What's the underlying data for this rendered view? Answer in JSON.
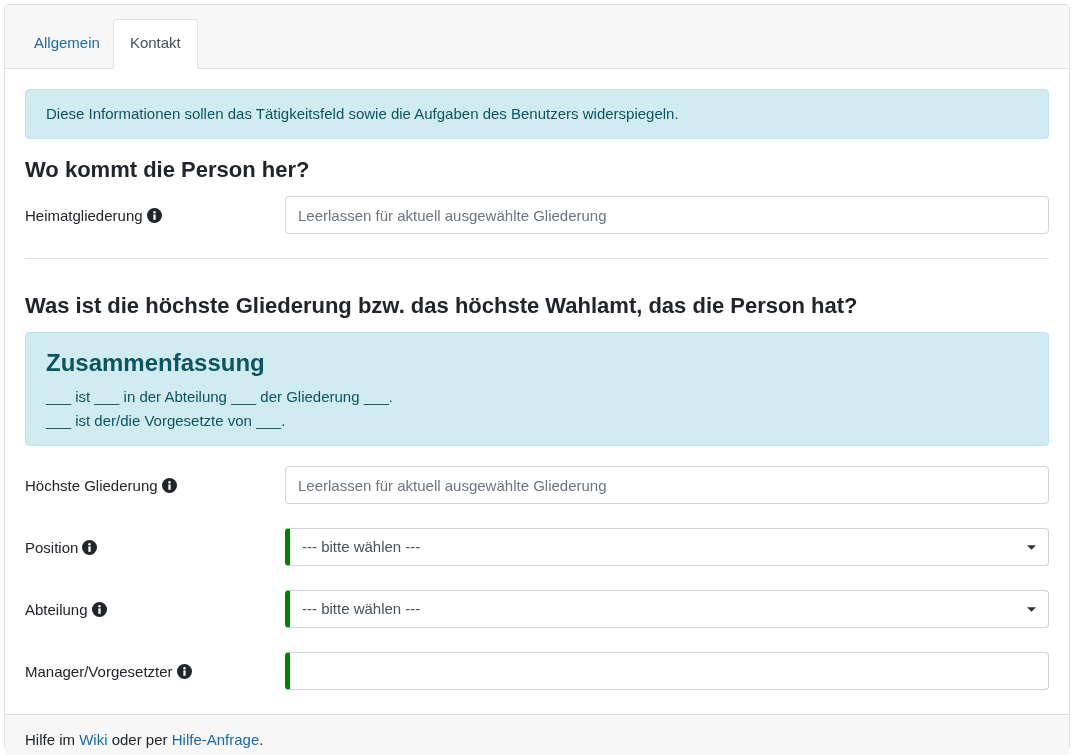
{
  "tabs": [
    {
      "label": "Allgemein",
      "selected": false
    },
    {
      "label": "Kontakt",
      "selected": true
    }
  ],
  "info_alert": "Diese Informationen sollen das Tätigkeitsfeld sowie die Aufgaben des Benutzers widerspiegeln.",
  "sections": [
    {
      "heading": "Wo kommt die Person her?",
      "fields": [
        {
          "kind": "text",
          "label": "Heimatgliederung",
          "placeholder": "Leerlassen für aktuell ausgewählte Gliederung",
          "validated": false
        }
      ]
    },
    {
      "heading": "Was ist die höchste Gliederung bzw. das höchste Wahlamt, das die Person hat?",
      "summary": {
        "title": "Zusammenfassung",
        "lines": [
          "___ ist ___ in der Abteilung ___ der Gliederung ___.",
          "___ ist der/die Vorgesetzte von ___."
        ]
      },
      "fields": [
        {
          "kind": "text",
          "label": "Höchste Gliederung",
          "placeholder": "Leerlassen für aktuell ausgewählte Gliederung",
          "validated": false
        },
        {
          "kind": "select",
          "label": "Position",
          "value": "--- bitte wählen ---",
          "validated": true
        },
        {
          "kind": "select",
          "label": "Abteilung",
          "value": "--- bitte wählen ---",
          "validated": true
        },
        {
          "kind": "text",
          "label": "Manager/Vorgesetzter",
          "validated": true
        }
      ]
    }
  ],
  "footer": [
    {
      "kind": "text",
      "text": "Hilfe im "
    },
    {
      "kind": "link",
      "text": "Wiki"
    },
    {
      "kind": "text",
      "text": " oder per "
    },
    {
      "kind": "link",
      "text": "Hilfe-Anfrage"
    },
    {
      "kind": "text",
      "text": "."
    }
  ]
}
